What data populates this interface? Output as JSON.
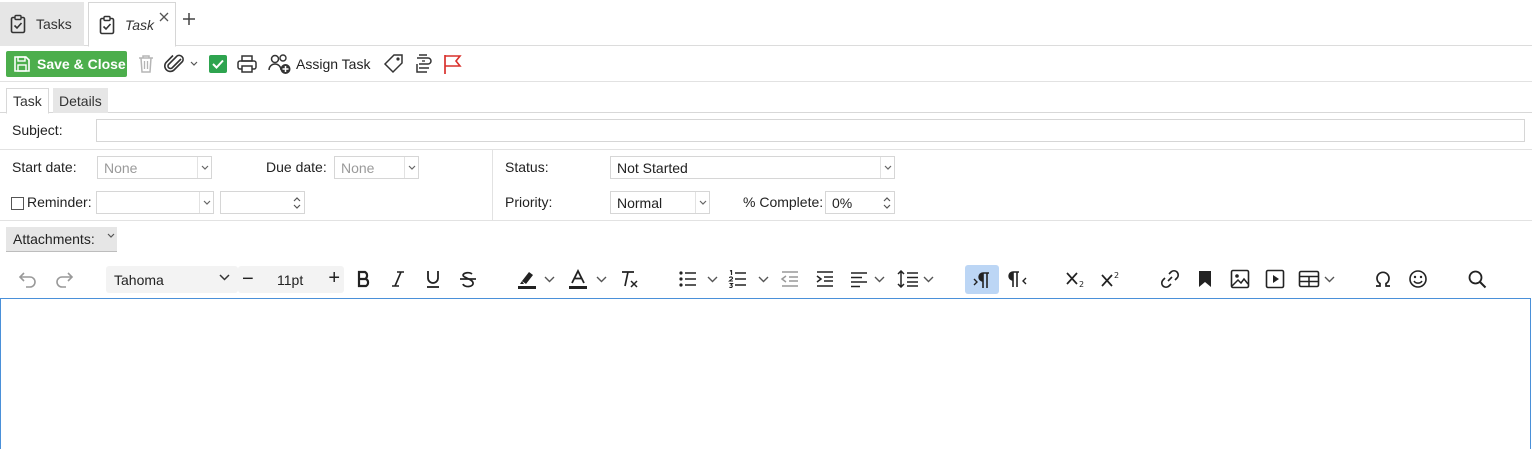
{
  "window_tabs": [
    {
      "label": "Tasks"
    },
    {
      "label": "Task"
    }
  ],
  "ribbon": {
    "save_close_label": "Save & Close",
    "assign_task_label": "Assign Task"
  },
  "form_tabs": [
    {
      "label": "Task"
    },
    {
      "label": "Details"
    }
  ],
  "form": {
    "subject_label": "Subject:",
    "subject_value": "",
    "start_date_label": "Start date:",
    "start_date_value": "None",
    "due_date_label": "Due date:",
    "due_date_value": "None",
    "status_label": "Status:",
    "status_value": "Not Started",
    "reminder_label": "Reminder:",
    "reminder_date_value": "",
    "reminder_time_value": "",
    "priority_label": "Priority:",
    "priority_value": "Normal",
    "percent_complete_label": "% Complete:",
    "percent_complete_value": "0%"
  },
  "attachments": {
    "label": "Attachments:"
  },
  "editor_toolbar": {
    "font_family": "Tahoma",
    "font_size": "11pt",
    "minus_symbol": "−",
    "plus_symbol": "+"
  },
  "colors": {
    "save_green": "#4cae4c",
    "flag_red": "#d9302c",
    "check_green": "#2ea44f",
    "active_toolbar_blue": "#bcd6f5",
    "editor_border": "#4a90d9"
  }
}
